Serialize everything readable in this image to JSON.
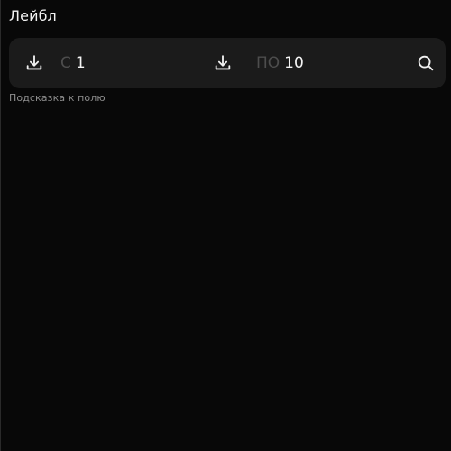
{
  "field": {
    "label": "Лейбл",
    "hint": "Подсказка к полю"
  },
  "range": {
    "from": {
      "prefix": "С",
      "value": "1",
      "icon": "download-icon"
    },
    "to": {
      "prefix": "ПО",
      "value": "10",
      "icon": "download-icon"
    },
    "search_icon": "search-icon"
  },
  "colors": {
    "page_background": "#080808",
    "field_background": "#1b1b1b",
    "text": "#f4f4f4",
    "prefix": "#4d4d4d",
    "hint": "#8e8e8e"
  }
}
